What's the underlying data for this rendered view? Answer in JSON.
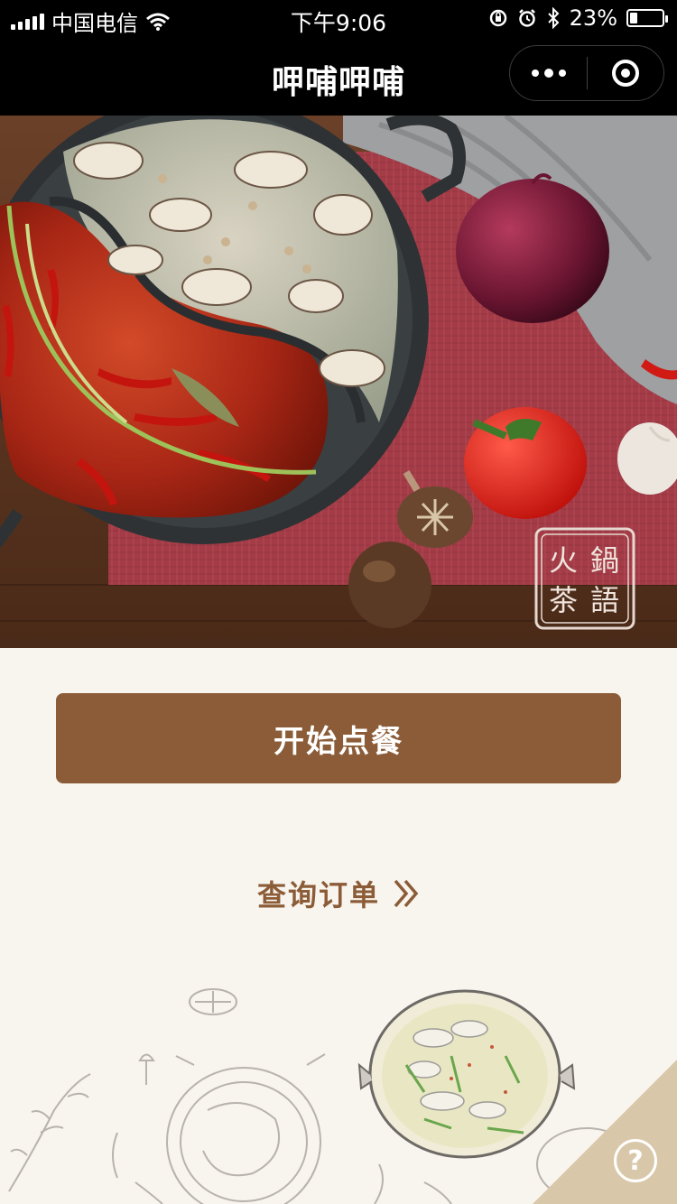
{
  "status_bar": {
    "carrier": "中国电信",
    "time": "下午9:06",
    "battery": "23%",
    "battery_level": 0.23
  },
  "nav": {
    "title": "呷哺呷哺"
  },
  "hero": {
    "logo_chars": [
      "火",
      "鍋",
      "茶",
      "語"
    ]
  },
  "actions": {
    "order_label": "开始点餐",
    "query_label": "查询订单"
  },
  "help": {
    "symbol": "?"
  },
  "colors": {
    "brand_brown": "#8b5c37",
    "background": "#f8f4ee",
    "corner_tan": "#d9c7a9"
  },
  "icons": [
    "wifi-icon",
    "rotation-lock-icon",
    "alarm-icon",
    "bluetooth-icon",
    "battery-icon",
    "more-icon",
    "close-icon",
    "double-chevron-right-icon",
    "help-icon"
  ]
}
